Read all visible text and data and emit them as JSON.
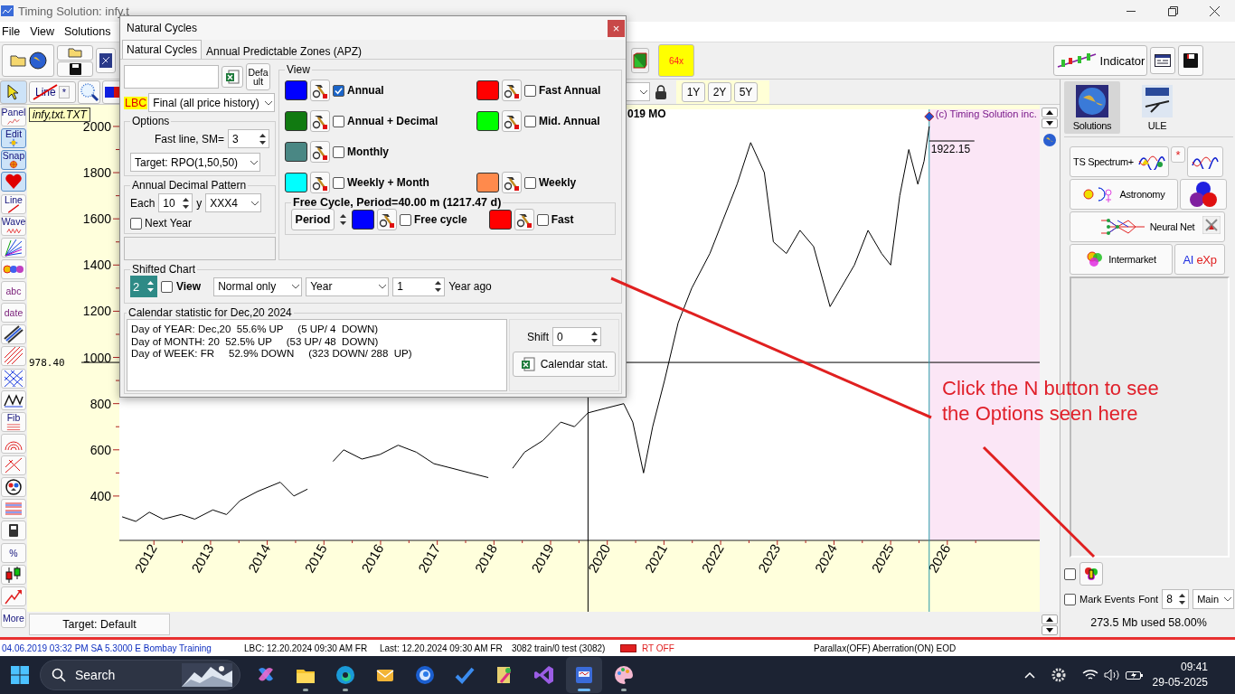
{
  "window": {
    "title": "Timing Solution:  infy,t"
  },
  "menu": [
    "File",
    "View",
    "Solutions"
  ],
  "toolbar": {
    "zoom_button": "64x",
    "indicator_button": "Indicator"
  },
  "chart_toolbar": {
    "line_button": "Line",
    "star_button": "*",
    "range_buttons": [
      "1Y",
      "2Y",
      "5Y"
    ]
  },
  "tools": [
    {
      "kind": "panel",
      "label": "Panel",
      "active": false
    },
    {
      "kind": "edit",
      "label": "Edit",
      "active": true
    },
    {
      "kind": "snap",
      "label": "Snap",
      "active": true
    },
    {
      "kind": "heart",
      "active": true
    },
    {
      "kind": "line",
      "label": "Line",
      "active": false
    },
    {
      "kind": "wave",
      "label": "Wave",
      "active": false
    },
    {
      "kind": "fan",
      "active": false
    },
    {
      "kind": "planets",
      "active": false
    },
    {
      "kind": "text",
      "label": "abc",
      "active": false
    },
    {
      "kind": "text",
      "label": "date",
      "active": false
    },
    {
      "kind": "channel",
      "active": false
    },
    {
      "kind": "hatch",
      "active": false
    },
    {
      "kind": "grid",
      "active": false
    },
    {
      "kind": "zigzag",
      "active": false
    },
    {
      "kind": "fib",
      "label": "Fib",
      "active": false
    },
    {
      "kind": "arcs",
      "active": false
    },
    {
      "kind": "cross",
      "active": false
    },
    {
      "kind": "circle",
      "active": false
    },
    {
      "kind": "stack",
      "active": false
    },
    {
      "kind": "calc",
      "active": false
    },
    {
      "kind": "text",
      "label": "%",
      "active": false
    },
    {
      "kind": "candles",
      "active": false
    },
    {
      "kind": "arrow",
      "active": false
    },
    {
      "kind": "text",
      "label": "More",
      "active": false
    }
  ],
  "chart": {
    "file_label": "infy,txt.TXT",
    "last_price": "1922.15",
    "date_label": "019 MO",
    "copyright": "(c) Timing Solution inc.",
    "target_tab": "Target: Default",
    "chart_data": {
      "type": "line",
      "xlim": [
        2011.39,
        2027.63
      ],
      "ylim": [
        208,
        2074
      ],
      "xticks": [
        2012,
        2013,
        2014,
        2015,
        2016,
        2017,
        2018,
        2019,
        2020,
        2021,
        2022,
        2023,
        2024,
        2025,
        2026
      ],
      "yticks": [
        400,
        600,
        800,
        1000,
        1200,
        1400,
        1600,
        1800,
        2000
      ],
      "x": [
        2011.44,
        2011.68,
        2011.92,
        2012.16,
        2012.48,
        2012.72,
        2013.04,
        2013.28,
        2013.52,
        2013.83,
        2014.23,
        2014.47,
        2014.71,
        2014.9,
        2015.16,
        2015.35,
        2015.67,
        2015.99,
        2016.31,
        2016.63,
        2016.94,
        2017.26,
        2017.58,
        2017.9,
        2018.11,
        2018.33,
        2018.54,
        2018.86,
        2019.18,
        2019.42,
        2019.66,
        2019.97,
        2020.29,
        2020.45,
        2020.64,
        2020.8,
        2021.01,
        2021.25,
        2021.49,
        2021.81,
        2022.05,
        2022.29,
        2022.53,
        2022.77,
        2022.93,
        2023.16,
        2023.4,
        2023.64,
        2023.93,
        2024.12,
        2024.36,
        2024.6,
        2024.84,
        2025.0,
        2025.16,
        2025.32,
        2025.48,
        2025.59,
        2025.68
      ],
      "series": [
        {
          "color": "#000000",
          "values": [
            310,
            290,
            330,
            300,
            320,
            300,
            340,
            320,
            380,
            420,
            460,
            400,
            430,
            null,
            550,
            600,
            560,
            580,
            620,
            590,
            540,
            520,
            500,
            480,
            null,
            520,
            590,
            640,
            720,
            700,
            760,
            780,
            800,
            720,
            500,
            700,
            900,
            1150,
            1300,
            1450,
            1600,
            1750,
            1930,
            1800,
            1500,
            1450,
            1550,
            1480,
            1220,
            1300,
            1400,
            1550,
            1450,
            1400,
            1700,
            1900,
            1750,
            1850,
            2000
          ]
        }
      ],
      "ref_lines": [
        {
          "axis": "y",
          "value": 978.4,
          "label": "978.40",
          "color": "#000000"
        },
        {
          "axis": "x",
          "value": 2019.66,
          "color": "#000000"
        },
        {
          "axis": "x",
          "value": 2025.68,
          "color": "#2a9aa8"
        }
      ],
      "bands": [
        {
          "axis": "x",
          "from": 2025.68,
          "to": 2027.63,
          "color": "#fbe6f6"
        }
      ]
    }
  },
  "right_panel": {
    "tiles": [
      {
        "label": "Solutions",
        "selected": true
      },
      {
        "label": "ULE",
        "selected": false
      }
    ],
    "modules": [
      "TS Spectrum+",
      "Astronomy",
      "Neural Net",
      "Intermarket"
    ],
    "spectrum_star": "*",
    "ai_button": {
      "first": "AI",
      "second": "eXp"
    },
    "n_checkbox": false,
    "mark_events": {
      "label": "Mark Events",
      "checked": false
    },
    "font_label": "Font",
    "font_size": "8",
    "layer": "Main",
    "memory": "273.5 Mb used 58.00%"
  },
  "dialog": {
    "title": "Natural Cycles",
    "close": "×",
    "tabs": [
      {
        "label": "Natural Cycles",
        "selected": true
      },
      {
        "label": "Annual Predictable Zones (APZ)",
        "selected": false
      }
    ],
    "default_button": "Default",
    "lbc_label": "LBC",
    "history": "Final (all price history)",
    "options": {
      "title": "Options",
      "fast_line_label": "Fast line, SM=",
      "fast_line_value": "3",
      "target": "Target: RPO(1,50,50)"
    },
    "decimal": {
      "title": "Annual Decimal Pattern",
      "each_label": "Each",
      "each_value": "10",
      "y_label": "y",
      "pattern": "XXX4",
      "next_year": {
        "label": "Next Year",
        "checked": false
      }
    },
    "view": {
      "title": "View",
      "rows": [
        {
          "cycles": [
            {
              "label": "Annual",
              "color": "#0000ff",
              "checked": true
            },
            {
              "label": "Fast Annual",
              "color": "#ff0000",
              "checked": false
            }
          ]
        },
        {
          "cycles": [
            {
              "label": "Annual + Decimal",
              "color": "#117a11",
              "checked": false
            },
            {
              "label": "Mid. Annual",
              "color": "#00ff00",
              "checked": false
            }
          ]
        },
        {
          "cycles": [
            {
              "label": "Monthly",
              "color": "#4a8784",
              "checked": false
            }
          ]
        },
        {
          "cycles": [
            {
              "label": "Weekly + Month",
              "color": "#00ffff",
              "checked": false
            },
            {
              "label": "Weekly",
              "color": "#ff8a4c",
              "checked": false
            }
          ]
        }
      ]
    },
    "free_cycle": {
      "title": "Free Cycle, Period=40.00 m (1217.47 d)",
      "period_button": "Period",
      "cycles": [
        {
          "label": "Free cycle",
          "color": "#0000ff",
          "checked": false
        },
        {
          "label": "Fast",
          "color": "#ff0000",
          "checked": false
        }
      ]
    },
    "shifted": {
      "title": "Shifted Chart",
      "count": "2",
      "view": {
        "label": "View",
        "checked": false
      },
      "mode": "Normal only",
      "unit": "Year",
      "amount": "1",
      "suffix": "Year ago"
    },
    "calendar": {
      "title": "Calendar statistic for  Dec,20  2024",
      "lines": [
        "Day of YEAR: Dec,20  55.6% UP     (5 UP/ 4  DOWN)",
        "Day of MONTH: 20  52.5% UP     (53 UP/ 48  DOWN)",
        "Day of WEEK: FR     52.9% DOWN     (323 DOWN/ 288  UP)"
      ],
      "shift_label": "Shift",
      "shift_value": "0",
      "button": "Calendar stat."
    }
  },
  "callout": {
    "text": "Click the N button to see the Options seen here"
  },
  "status_bar": {
    "session": "04.06.2019  03:32 PM SA    5.3000 E Bombay   Training",
    "lbc": "LBC: 12.20.2024  09:30 AM FR",
    "last": "Last: 12.20.2024  09:30 AM FR",
    "tests": "3082 train/0 test (3082)",
    "realtime": "RT OFF",
    "flags": "Parallax(OFF) Aberration(ON) EOD"
  },
  "taskbar": {
    "search": "Search",
    "apps": [
      {
        "kind": "copilot",
        "running": false,
        "selected": false
      },
      {
        "kind": "files",
        "running": true,
        "selected": false
      },
      {
        "kind": "edge",
        "running": true,
        "selected": false
      },
      {
        "kind": "mail",
        "running": false,
        "selected": false
      },
      {
        "kind": "bird",
        "running": false,
        "selected": false
      },
      {
        "kind": "todo",
        "running": false,
        "selected": false
      },
      {
        "kind": "tools",
        "running": false,
        "selected": false
      },
      {
        "kind": "studio",
        "running": false,
        "selected": false
      },
      {
        "kind": "timing",
        "running": true,
        "selected": true
      },
      {
        "kind": "paint",
        "running": true,
        "selected": false
      }
    ],
    "time": "09:41",
    "date": "29-05-2025"
  }
}
